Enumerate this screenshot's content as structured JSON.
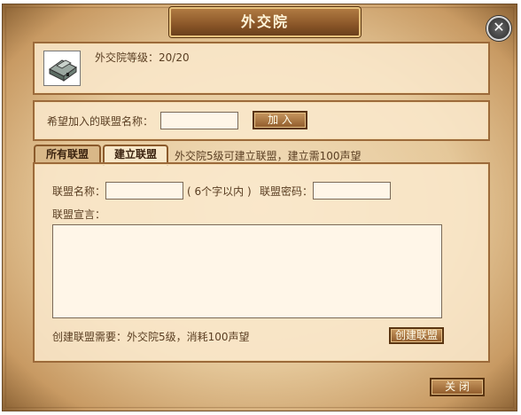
{
  "window": {
    "title": "外交院",
    "close_icon": "close-icon"
  },
  "info": {
    "level_text": "外交院等级：20/20",
    "building_icon": "embassy-building-icon"
  },
  "join": {
    "label": "希望加入的联盟名称：",
    "input_value": "",
    "button_label": "加 入"
  },
  "tabs": [
    {
      "label": "所有联盟"
    },
    {
      "label": "建立联盟"
    }
  ],
  "tab_note": "外交院5级可建立联盟，建立需100声望",
  "create": {
    "name_label": "联盟名称：",
    "name_value": "",
    "name_hint": "( 6个字以内 )",
    "password_label": "联盟密码：",
    "password_value": "",
    "declaration_label": "联盟宣言：",
    "declaration_value": "",
    "requirement_text": "创建联盟需要：外交院5级，消耗100声望",
    "create_button_label": "创建联盟"
  },
  "footer": {
    "close_button_label": "关 闭"
  }
}
